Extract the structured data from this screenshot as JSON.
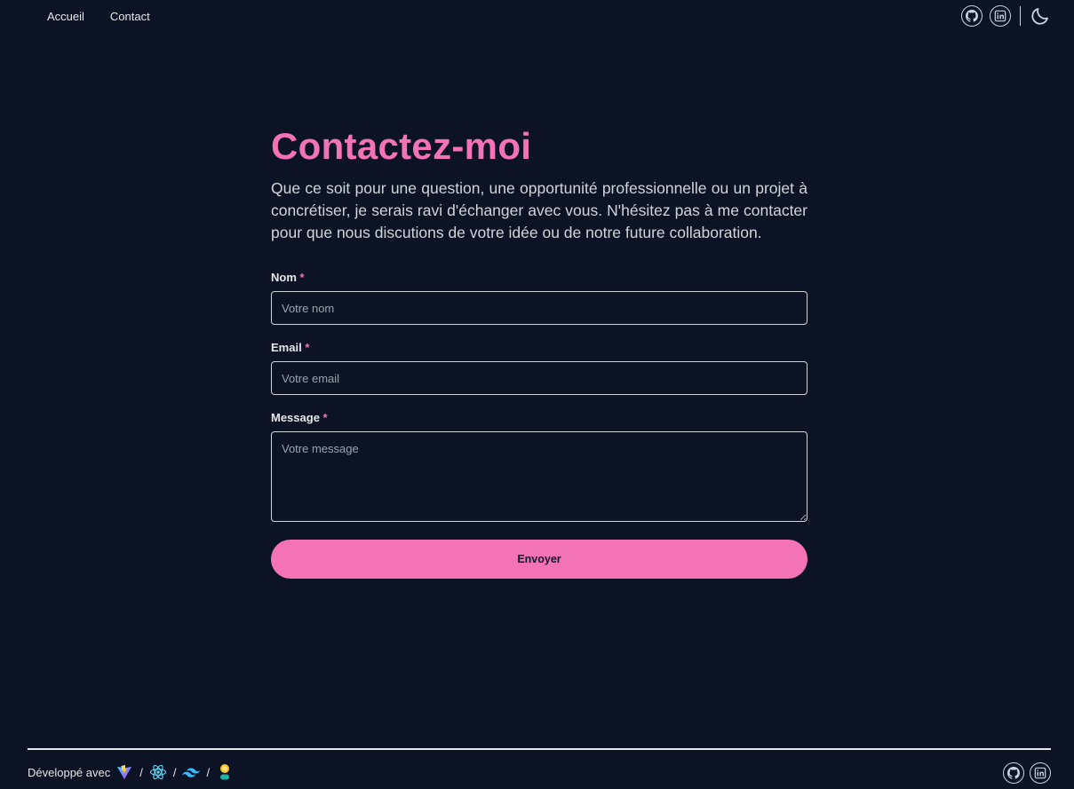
{
  "nav": {
    "links": [
      "Accueil",
      "Contact"
    ],
    "icons": [
      "github-icon",
      "linkedin-icon",
      "moon-icon"
    ]
  },
  "main": {
    "title": "Contactez-moi",
    "intro": "Que ce soit pour une question, une opportunité professionnelle ou un projet à concrétiser, je serais ravi d'échanger avec vous. N'hésitez pas à me contacter pour que nous discutions de votre idée ou de notre future collaboration.",
    "form": {
      "name_label": "Nom",
      "name_placeholder": "Votre nom",
      "email_label": "Email",
      "email_placeholder": "Votre email",
      "message_label": "Message",
      "message_placeholder": "Votre message",
      "required_marker": "*",
      "submit_label": "Envoyer"
    }
  },
  "footer": {
    "built_with": "Développé avec",
    "separator": "/",
    "tech_icons": [
      "vite-icon",
      "react-icon",
      "tailwind-icon",
      "daisyui-icon"
    ],
    "social_icons": [
      "github-icon",
      "linkedin-icon"
    ]
  },
  "colors": {
    "background": "#0b1324",
    "accent": "#f472b6",
    "text": "#e5e7eb"
  }
}
